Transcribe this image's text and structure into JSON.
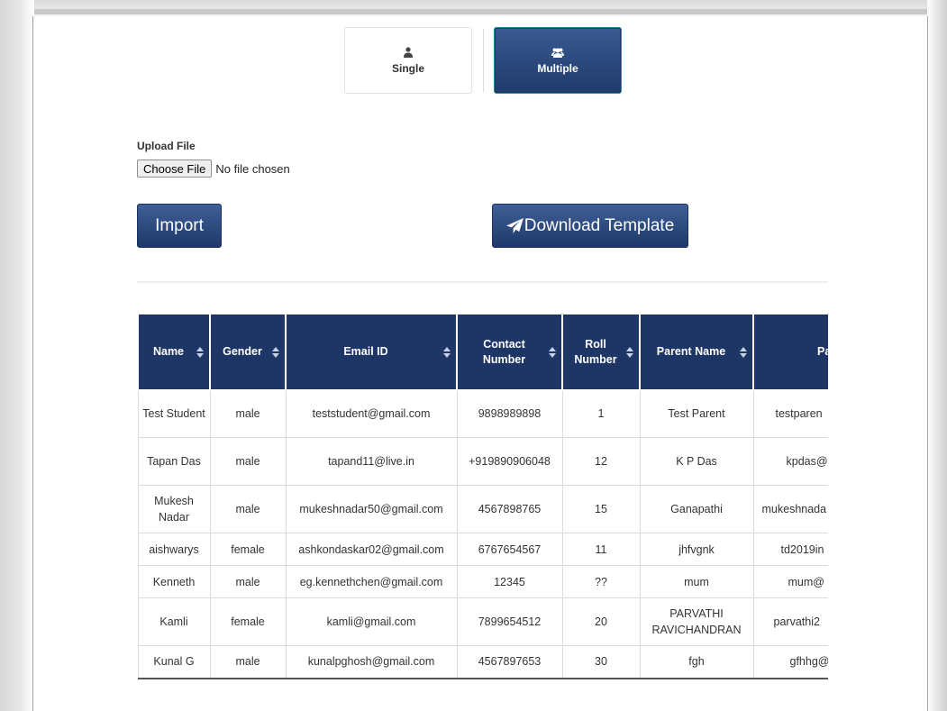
{
  "modes": {
    "single_label": "Single",
    "multiple_label": "Multiple"
  },
  "upload": {
    "label": "Upload File",
    "choose_button": "Choose File",
    "status": "No file chosen"
  },
  "actions": {
    "import_label": "Import",
    "download_label": "Download Template"
  },
  "table": {
    "headers": {
      "name": "Name",
      "gender": "Gender",
      "email": "Email ID",
      "contact": "Contact Number",
      "roll": "Roll Number",
      "parent_name": "Parent Name",
      "parent_email": "Parent Email"
    },
    "rows": [
      {
        "name": "Test Student",
        "gender": "male",
        "email": "teststudent@gmail.com",
        "contact": "9898989898",
        "roll": "1",
        "parent_name": "Test Parent",
        "parent_email": "testparen"
      },
      {
        "name": "Tapan Das",
        "gender": "male",
        "email": "tapand11@live.in",
        "contact": "+919890906048",
        "roll": "12",
        "parent_name": "K P Das",
        "parent_email": "kpdas@"
      },
      {
        "name": "Mukesh Nadar",
        "gender": "male",
        "email": "mukeshnadar50@gmail.com",
        "contact": "4567898765",
        "roll": "15",
        "parent_name": "Ganapathi",
        "parent_email": "mukeshnada"
      },
      {
        "name": "aishwarys",
        "gender": "female",
        "email": "ashkondaskar02@gmail.com",
        "contact": "6767654567",
        "roll": "11",
        "parent_name": "jhfvgnk",
        "parent_email": "td2019in"
      },
      {
        "name": "Kenneth",
        "gender": "male",
        "email": "eg.kennethchen@gmail.com",
        "contact": "12345",
        "roll": "??",
        "parent_name": "mum",
        "parent_email": "mum@"
      },
      {
        "name": "Kamli",
        "gender": "female",
        "email": "kamli@gmail.com",
        "contact": "7899654512",
        "roll": "20",
        "parent_name": "PARVATHI RAVICHANDRAN",
        "parent_email": "parvathi2"
      },
      {
        "name": "Kunal G",
        "gender": "male",
        "email": "kunalpghosh@gmail.com",
        "contact": "4567897653",
        "roll": "30",
        "parent_name": "fgh",
        "parent_email": "gfhhg@"
      }
    ]
  },
  "colors": {
    "primary": "#1e3666",
    "accent_border": "#2a8a9a"
  }
}
